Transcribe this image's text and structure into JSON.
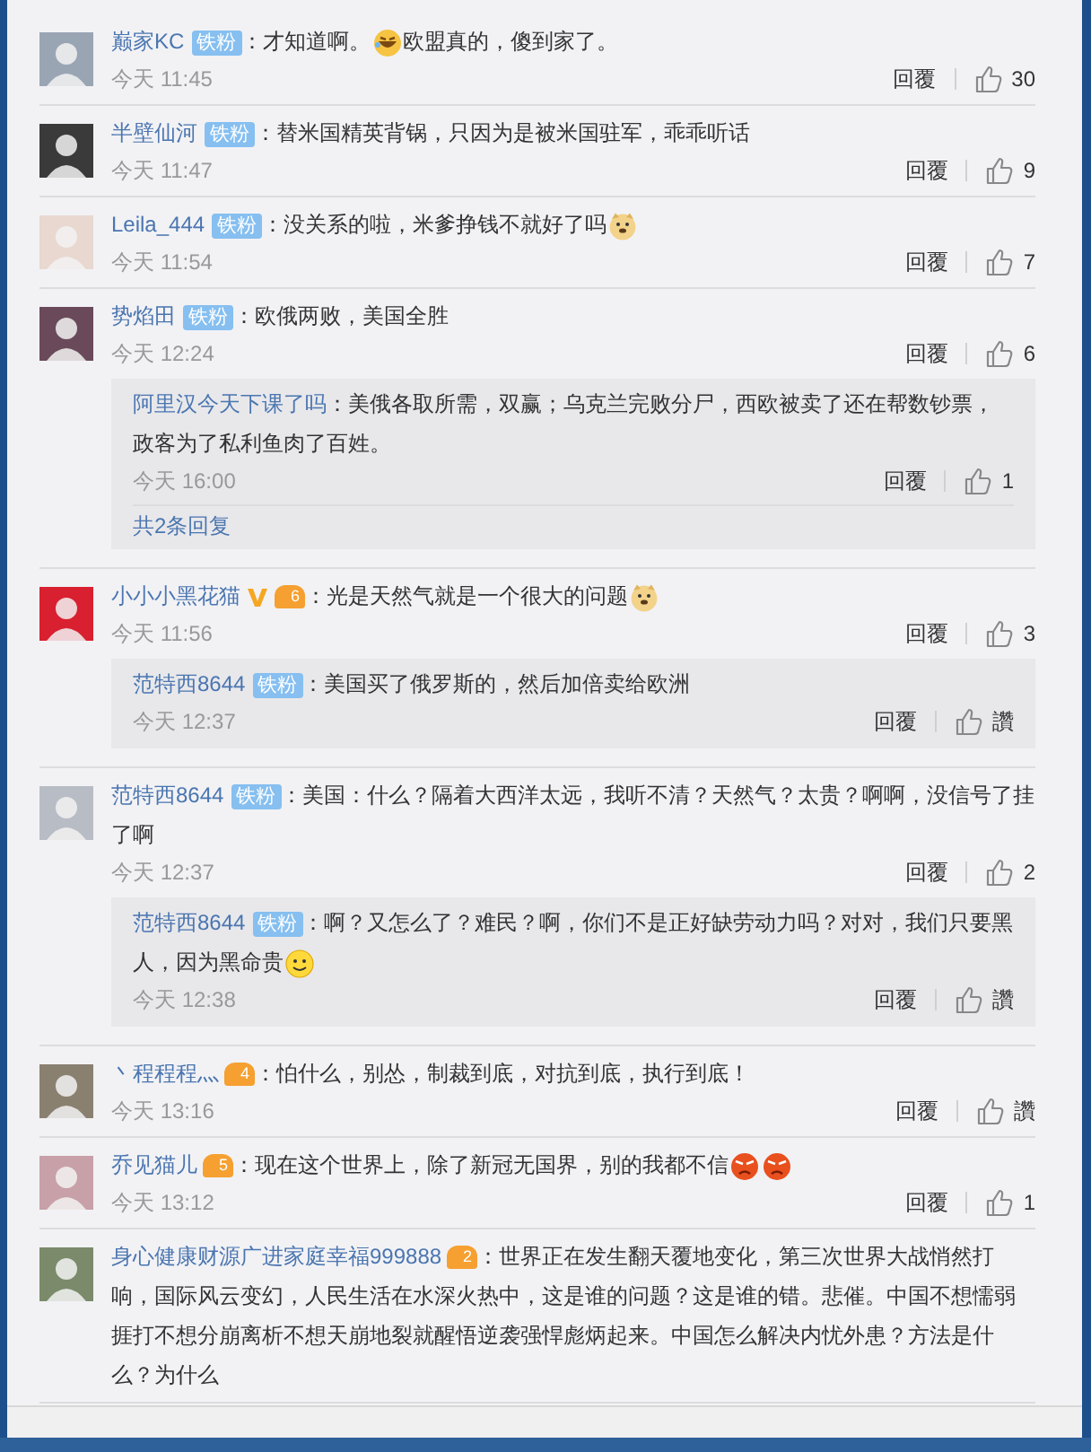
{
  "comments": [
    {
      "user": "巅家KC",
      "badge": "铁粉",
      "text": [
        {
          "kind": "text",
          "text": "：才知道啊。"
        },
        {
          "kind": "laugh"
        },
        {
          "kind": "text",
          "text": "欧盟真的，傻到家了。"
        }
      ],
      "time": "今天 11:45",
      "reply_label": "回覆",
      "likes": "30"
    },
    {
      "user": "半壁仙河",
      "badge": "铁粉",
      "text": [
        {
          "kind": "text",
          "text": "：替米国精英背锅，只因为是被米国驻军，乖乖听话"
        }
      ],
      "time": "今天 11:47",
      "reply_label": "回覆",
      "likes": "9"
    },
    {
      "user": "Leila_444",
      "badge": "铁粉",
      "text": [
        {
          "kind": "text",
          "text": "：没关系的啦，米爹挣钱不就好了吗"
        },
        {
          "kind": "doge"
        }
      ],
      "time": "今天 11:54",
      "reply_label": "回覆",
      "likes": "7"
    },
    {
      "user": "势焰田",
      "badge": "铁粉",
      "text": [
        {
          "kind": "text",
          "text": "：欧俄两败，美国全胜"
        }
      ],
      "time": "今天 12:24",
      "reply_label": "回覆",
      "likes": "6",
      "replies": [
        {
          "user": "阿里汉今天下课了吗",
          "text": [
            {
              "kind": "text",
              "text": "：美俄各取所需，双赢；乌克兰完败分尸，西欧被卖了还在帮数钞票，政客为了私利鱼肉了百姓。"
            }
          ],
          "time": "今天 16:00",
          "reply_label": "回覆",
          "likes": "1"
        }
      ],
      "more_replies": "共2条回复"
    },
    {
      "user": "小小小黑花猫",
      "verified": true,
      "crown": "6",
      "text": [
        {
          "kind": "text",
          "text": "：光是天然气就是一个很大的问题"
        },
        {
          "kind": "doge"
        }
      ],
      "time": "今天 11:56",
      "reply_label": "回覆",
      "likes": "3",
      "replies": [
        {
          "user": "范特西8644",
          "badge": "铁粉",
          "text": [
            {
              "kind": "text",
              "text": "：美国买了俄罗斯的，然后加倍卖给欧洲"
            }
          ],
          "time": "今天 12:37",
          "reply_label": "回覆",
          "likes": "讚"
        }
      ]
    },
    {
      "user": "范特西8644",
      "badge": "铁粉",
      "text": [
        {
          "kind": "text",
          "text": "：美国：什么？隔着大西洋太远，我听不清？天然气？太贵？啊啊，没信号了挂了啊"
        }
      ],
      "time": "今天 12:37",
      "reply_label": "回覆",
      "likes": "2",
      "replies": [
        {
          "user": "范特西8644",
          "badge": "铁粉",
          "text": [
            {
              "kind": "text",
              "text": "：啊？又怎么了？难民？啊，你们不是正好缺劳动力吗？对对，我们只要黑人，因为黑命贵"
            },
            {
              "kind": "smile"
            }
          ],
          "time": "今天 12:38",
          "reply_label": "回覆",
          "likes": "讚"
        }
      ]
    },
    {
      "user": "丶程程程灬",
      "crown": "4",
      "text": [
        {
          "kind": "text",
          "text": "：怕什么，别怂，制裁到底，对抗到底，执行到底！"
        }
      ],
      "time": "今天 13:16",
      "reply_label": "回覆",
      "likes": "讚"
    },
    {
      "user": "乔见猫儿",
      "crown": "5",
      "text": [
        {
          "kind": "text",
          "text": "：现在这个世界上，除了新冠无国界，别的我都不信"
        },
        {
          "kind": "angry"
        },
        {
          "kind": "angry"
        }
      ],
      "time": "今天 13:12",
      "reply_label": "回覆",
      "likes": "1"
    },
    {
      "user": "身心健康财源广进家庭幸福999888",
      "crown": "2",
      "text": [
        {
          "kind": "text",
          "text": "：世界正在发生翻天覆地变化，第三次世界大战悄然打响，国际风云变幻，人民生活在水深火热中，这是谁的问题？这是谁的错。悲催。中国不想懦弱捱打不想分崩离析不想天崩地裂就醒悟逆袭强悍彪炳起来。中国怎么解决内忧外患？方法是什么？为什么"
        }
      ]
    }
  ]
}
